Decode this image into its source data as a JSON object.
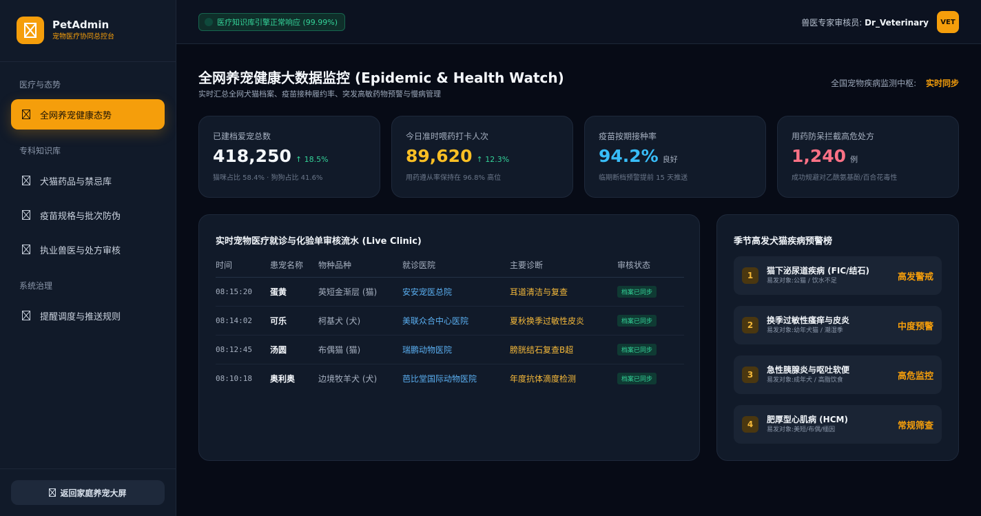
{
  "brand": {
    "name": "PetAdmin",
    "subtitle": "宠物医疗协同总控台"
  },
  "sidebar": {
    "sections": [
      {
        "title": "医疗与态势"
      },
      {
        "title": "专科知识库"
      },
      {
        "title": "系统治理"
      }
    ],
    "items": [
      {
        "label": "全网养宠健康态势",
        "active": true
      },
      {
        "label": "犬猫药品与禁忌库"
      },
      {
        "label": "疫苗规格与批次防伪"
      },
      {
        "label": "执业兽医与处方审核"
      },
      {
        "label": "提醒调度与推送规则"
      }
    ],
    "back_label": "返回家庭养宠大屏"
  },
  "topbar": {
    "status": "医疗知识库引擎正常响应 (99.99%)",
    "reviewer_label": "兽医专家审核员:",
    "reviewer_name": "Dr_Veterinary",
    "avatar": "VET"
  },
  "header": {
    "title": "全网养宠健康大数据监控 (Epidemic & Health Watch)",
    "subtitle": "实时汇总全网犬猫档案、疫苗接种履约率、突发高敏药物预警与慢病管理",
    "sync_label": "全国宠物疾病监测中枢:",
    "sync_value": "实时同步"
  },
  "kpis": [
    {
      "label": "已建档爱宠总数",
      "value": "418,250",
      "delta": "↑ 18.5%",
      "note": "猫咪占比 58.4% · 狗狗占比 41.6%",
      "color": "#f4f7fb",
      "delta_color": "#34d399"
    },
    {
      "label": "今日准时喂药打卡人次",
      "value": "89,620",
      "delta": "↑ 12.3%",
      "note": "用药遵从率保持在 96.8% 高位",
      "color": "#fbbf24",
      "delta_color": "#34d399"
    },
    {
      "label": "疫苗按期接种率",
      "value": "94.2%",
      "delta": "良好",
      "note": "临期断档预警提前 15 天推送",
      "color": "#38bdf8",
      "delta_color": "#a6b0c0"
    },
    {
      "label": "用药防呆拦截高危处方",
      "value": "1,240",
      "delta": "例",
      "note": "成功规避对乙酰氨基酚/百合花毒性",
      "color": "#fb7185",
      "delta_color": "#a6b0c0"
    }
  ],
  "clinic": {
    "title": "实时宠物医疗就诊与化验单审核流水 (Live Clinic)",
    "columns": [
      "时间",
      "患宠名称",
      "物种品种",
      "就诊医院",
      "主要诊断",
      "审核状态"
    ],
    "rows": [
      {
        "time": "08:15:20",
        "pet": "蛋黄",
        "breed": "英短金渐层 (猫)",
        "hospital": "安安宠医总院",
        "diagnosis": "耳道清洁与复查",
        "status": "档案已同步"
      },
      {
        "time": "08:14:02",
        "pet": "可乐",
        "breed": "柯基犬 (犬)",
        "hospital": "美联众合中心医院",
        "diagnosis": "夏秋换季过敏性皮炎",
        "status": "档案已同步"
      },
      {
        "time": "08:12:45",
        "pet": "汤圆",
        "breed": "布偶猫 (猫)",
        "hospital": "瑞鹏动物医院",
        "diagnosis": "膀胱结石复查B超",
        "status": "档案已同步"
      },
      {
        "time": "08:10:18",
        "pet": "奥利奥",
        "breed": "边境牧羊犬 (犬)",
        "hospital": "芭比堂国际动物医院",
        "diagnosis": "年度抗体滴度检测",
        "status": "档案已同步"
      }
    ]
  },
  "ranking": {
    "title": "季节高发犬猫疾病预警榜",
    "items": [
      {
        "rank": "1",
        "name": "猫下泌尿道疾病 (FIC/结石)",
        "target": "易发对象:公猫 / 饮水不足",
        "level": "高发警戒"
      },
      {
        "rank": "2",
        "name": "换季过敏性瘙痒与皮炎",
        "target": "易发对象:幼年犬猫 / 潮湿季",
        "level": "中度预警"
      },
      {
        "rank": "3",
        "name": "急性胰腺炎与呕吐软便",
        "target": "易发对象:成年犬 / 高脂饮食",
        "level": "高危监控"
      },
      {
        "rank": "4",
        "name": "肥厚型心肌病 (HCM)",
        "target": "易发对象:美短/布偶/缅因",
        "level": "常规筛查"
      }
    ]
  }
}
